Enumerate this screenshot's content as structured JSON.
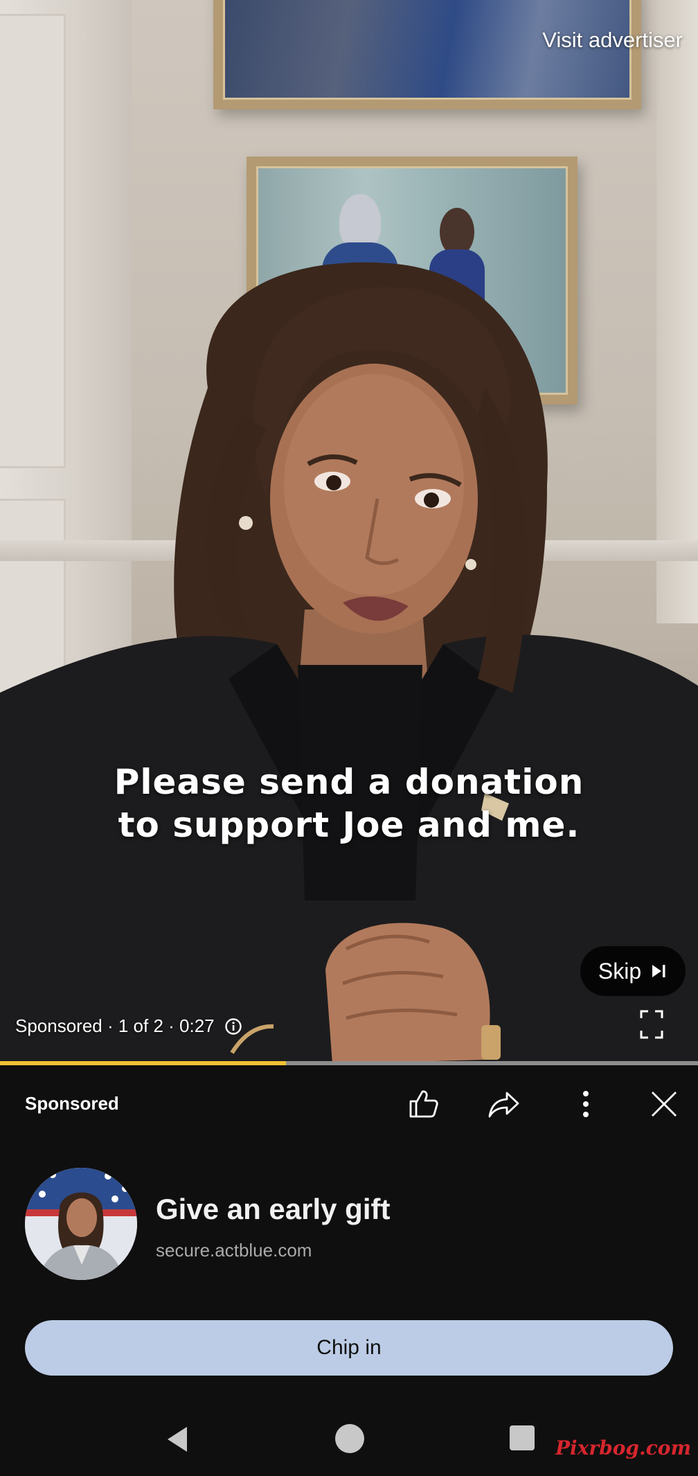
{
  "video": {
    "visit_advertiser": "Visit advertiser",
    "caption_line1": "Please send a donation",
    "caption_line2": "to support Joe and me.",
    "skip_label": "Skip",
    "ad_meta": "Sponsored · 1 of 2 · 0:27",
    "progress": 0.41
  },
  "panel": {
    "sponsored_label": "Sponsored",
    "toolbar_icons": [
      "thumbs-up-icon",
      "share-icon",
      "more-vert-icon",
      "close-icon"
    ],
    "ad_title": "Give an early gift",
    "ad_url": "secure.actblue.com",
    "cta_label": "Chip in"
  },
  "navbar": {
    "icons": [
      "back-icon",
      "home-icon",
      "recents-icon"
    ]
  },
  "watermark": "Pixrbog.com",
  "colors": {
    "progress_fill": "#f1c232",
    "cta_background": "#bccce6",
    "panel_background": "#0f0f0f",
    "watermark": "#d7262e"
  }
}
